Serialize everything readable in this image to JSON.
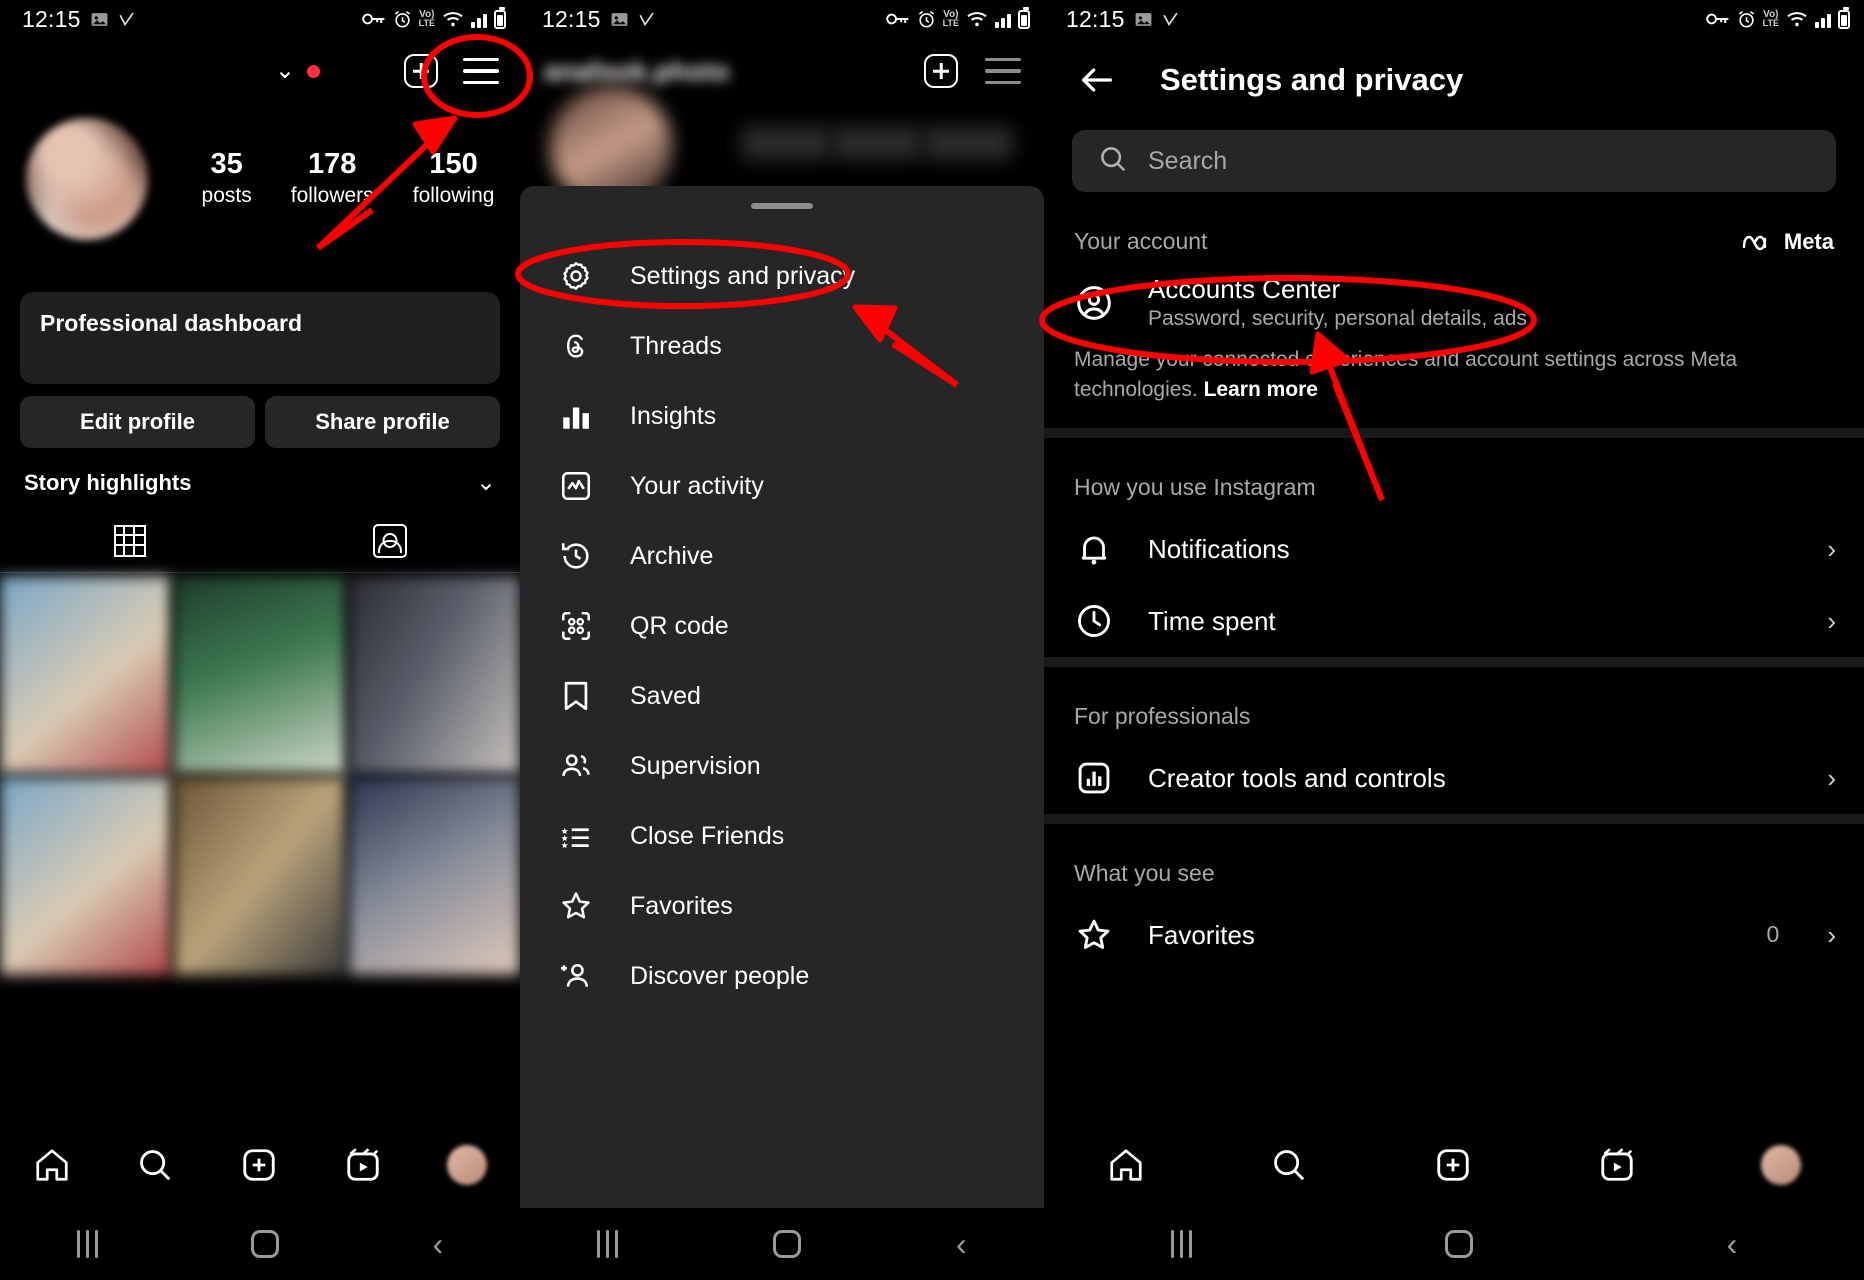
{
  "status_bar": {
    "time": "12:15",
    "lte_label": "Vo)",
    "lte_sub": "LTE"
  },
  "panel_profile": {
    "stats": [
      {
        "number": "35",
        "label": "posts"
      },
      {
        "number": "178",
        "label": "followers"
      },
      {
        "number": "150",
        "label": "following"
      }
    ],
    "professional_dashboard": "Professional dashboard",
    "edit_profile": "Edit profile",
    "share_profile": "Share profile",
    "story_highlights": "Story highlights"
  },
  "panel_menu": {
    "items": [
      {
        "label": "Settings and privacy",
        "icon": "gear-icon"
      },
      {
        "label": "Threads",
        "icon": "threads-icon"
      },
      {
        "label": "Insights",
        "icon": "insights-icon"
      },
      {
        "label": "Your activity",
        "icon": "activity-icon"
      },
      {
        "label": "Archive",
        "icon": "archive-icon"
      },
      {
        "label": "QR code",
        "icon": "qr-code-icon"
      },
      {
        "label": "Saved",
        "icon": "bookmark-icon"
      },
      {
        "label": "Supervision",
        "icon": "people-icon"
      },
      {
        "label": "Close Friends",
        "icon": "close-friends-icon"
      },
      {
        "label": "Favorites",
        "icon": "star-icon"
      },
      {
        "label": "Discover people",
        "icon": "discover-people-icon"
      }
    ]
  },
  "panel_settings": {
    "title": "Settings and privacy",
    "search_placeholder": "Search",
    "sections": [
      {
        "title": "Your account",
        "meta_label": "Meta",
        "rows": [
          {
            "title": "Accounts Center",
            "subtitle": "Password, security, personal details, ads",
            "icon": "account-circle-icon"
          }
        ],
        "note_text": "Manage your connected experiences and account settings across Meta technologies. ",
        "note_link": "Learn more"
      },
      {
        "title": "How you use Instagram",
        "rows": [
          {
            "title": "Notifications",
            "icon": "bell-icon",
            "chevron": "›"
          },
          {
            "title": "Time spent",
            "icon": "clock-icon",
            "chevron": "›"
          }
        ]
      },
      {
        "title": "For professionals",
        "rows": [
          {
            "title": "Creator tools and controls",
            "icon": "bar-chart-icon",
            "chevron": "›"
          }
        ]
      },
      {
        "title": "What you see",
        "rows": [
          {
            "title": "Favorites",
            "icon": "star-icon",
            "count": "0",
            "chevron": "›"
          }
        ]
      }
    ]
  },
  "bottom_nav": {
    "items": [
      "home-icon",
      "search-icon",
      "create-icon",
      "reels-icon",
      "profile-avatar"
    ]
  },
  "android_nav": {
    "items": [
      "recents-button",
      "home-button",
      "back-button"
    ]
  },
  "annotations": {
    "accent_color": "#ff0000",
    "highlights": [
      "hamburger-menu-button",
      "settings-and-privacy-menu-item",
      "accounts-center-row"
    ],
    "arrows": 3
  }
}
